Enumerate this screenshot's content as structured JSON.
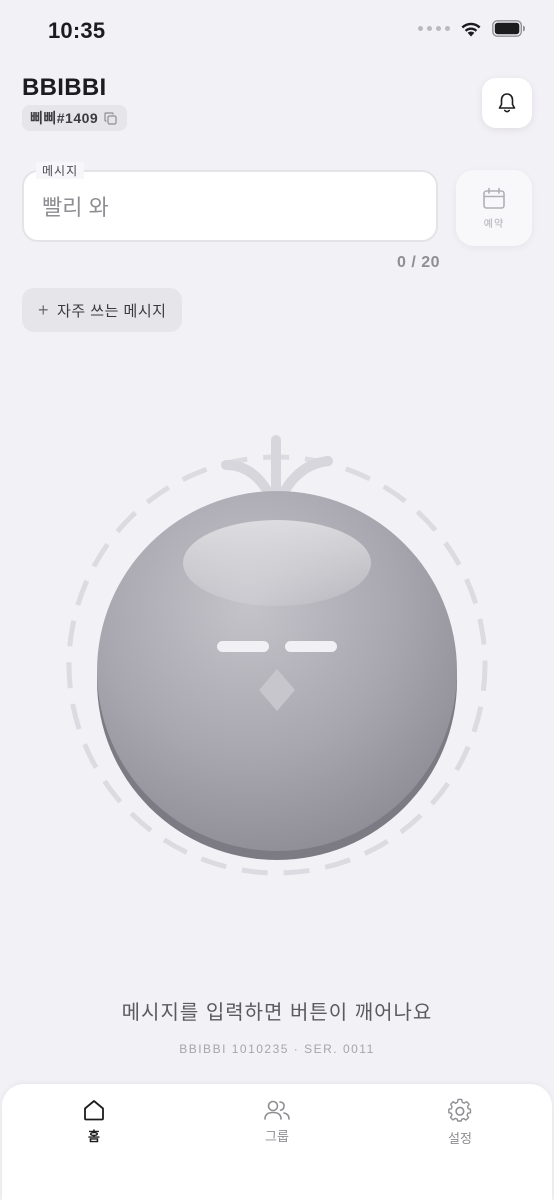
{
  "status_bar": {
    "time": "10:35"
  },
  "header": {
    "title": "BBIBBI",
    "user_tag": "삐삐#1409",
    "copy_icon": "copy-icon",
    "bell_icon": "bell-icon"
  },
  "message": {
    "label": "메시지",
    "value": "빨리 와",
    "char_count": "0 / 20",
    "max_length": 20
  },
  "reserve": {
    "label": "예약",
    "icon": "calendar-icon"
  },
  "frequent": {
    "plus": "+",
    "label": "자주 쓰는 메시지"
  },
  "main": {
    "hint": "메시지를 입력하면 버튼이 깨어나요",
    "serial": "BBIBBI 1010235 · SER. 0011"
  },
  "tabs": [
    {
      "label": "홈",
      "icon": "home-icon",
      "active": true
    },
    {
      "label": "그룹",
      "icon": "users-icon",
      "active": false
    },
    {
      "label": "설정",
      "icon": "gear-icon",
      "active": false
    }
  ],
  "colors": {
    "background": "#f2f1f6",
    "button_gray": "#a3a2aa",
    "text_primary": "#1c1c1e",
    "text_secondary": "#8e8e93"
  }
}
